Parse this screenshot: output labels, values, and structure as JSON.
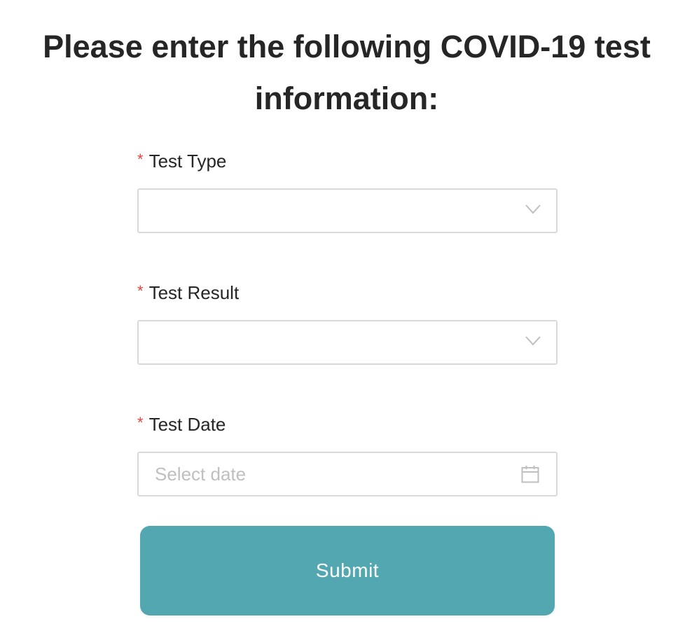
{
  "page": {
    "title": "Please enter the following COVID-19 test information:"
  },
  "form": {
    "fields": [
      {
        "required_mark": "*",
        "label": "Test Type",
        "control_type": "select",
        "value": "",
        "icon": "chevron-down-icon"
      },
      {
        "required_mark": "*",
        "label": "Test Result",
        "control_type": "select",
        "value": "",
        "icon": "chevron-down-icon"
      },
      {
        "required_mark": "*",
        "label": "Test Date",
        "control_type": "date",
        "value": "",
        "placeholder": "Select date",
        "icon": "calendar-icon"
      }
    ],
    "submit_label": "Submit"
  },
  "colors": {
    "accent": "#52a7b1",
    "required": "#e8403f",
    "border": "#d9d9d9",
    "placeholder": "#bfbfbf",
    "text": "#262626"
  }
}
